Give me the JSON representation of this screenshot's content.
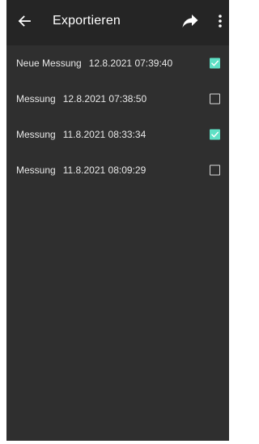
{
  "appbar": {
    "title": "Exportieren",
    "back_icon": "arrow-left-icon",
    "share_icon": "share-icon",
    "more_icon": "more-vert-icon"
  },
  "colors": {
    "background": "#2f2f2f",
    "appbar": "#252525",
    "accent": "#5fe0c5"
  },
  "measurements": [
    {
      "name": "Neue Messung",
      "datetime": "12.8.2021 07:39:40",
      "checked": true
    },
    {
      "name": "Messung",
      "datetime": "12.8.2021 07:38:50",
      "checked": false
    },
    {
      "name": "Messung",
      "datetime": "11.8.2021 08:33:34",
      "checked": true
    },
    {
      "name": "Messung",
      "datetime": "11.8.2021 08:09:29",
      "checked": false
    }
  ]
}
